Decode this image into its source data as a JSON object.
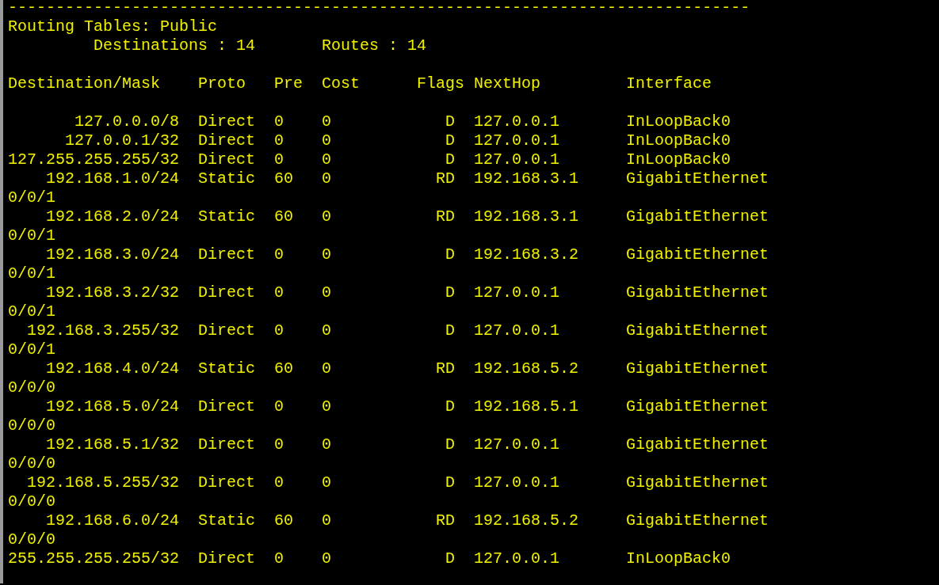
{
  "separator": "------------------------------------------------------------------------------",
  "title": "Routing Tables: Public",
  "summary": {
    "destinations": "Destinations : 14",
    "routes": "Routes : 14"
  },
  "columns": [
    "Destination/Mask",
    "Proto",
    "Pre",
    "Cost",
    "Flags",
    "NextHop",
    "Interface"
  ],
  "rows": [
    {
      "destination": "127.0.0.0/8",
      "proto": "Direct",
      "pre": "0",
      "cost": "0",
      "flags": "D",
      "nexthop": "127.0.0.1",
      "interface": "InLoopBack0"
    },
    {
      "destination": "127.0.0.1/32",
      "proto": "Direct",
      "pre": "0",
      "cost": "0",
      "flags": "D",
      "nexthop": "127.0.0.1",
      "interface": "InLoopBack0"
    },
    {
      "destination": "127.255.255.255/32",
      "proto": "Direct",
      "pre": "0",
      "cost": "0",
      "flags": "D",
      "nexthop": "127.0.0.1",
      "interface": "InLoopBack0"
    },
    {
      "destination": "192.168.1.0/24",
      "proto": "Static",
      "pre": "60",
      "cost": "0",
      "flags": "RD",
      "nexthop": "192.168.3.1",
      "interface": "GigabitEthernet",
      "interface_continued": "0/0/1"
    },
    {
      "destination": "192.168.2.0/24",
      "proto": "Static",
      "pre": "60",
      "cost": "0",
      "flags": "RD",
      "nexthop": "192.168.3.1",
      "interface": "GigabitEthernet",
      "interface_continued": "0/0/1"
    },
    {
      "destination": "192.168.3.0/24",
      "proto": "Direct",
      "pre": "0",
      "cost": "0",
      "flags": "D",
      "nexthop": "192.168.3.2",
      "interface": "GigabitEthernet",
      "interface_continued": "0/0/1"
    },
    {
      "destination": "192.168.3.2/32",
      "proto": "Direct",
      "pre": "0",
      "cost": "0",
      "flags": "D",
      "nexthop": "127.0.0.1",
      "interface": "GigabitEthernet",
      "interface_continued": "0/0/1"
    },
    {
      "destination": "192.168.3.255/32",
      "proto": "Direct",
      "pre": "0",
      "cost": "0",
      "flags": "D",
      "nexthop": "127.0.0.1",
      "interface": "GigabitEthernet",
      "interface_continued": "0/0/1"
    },
    {
      "destination": "192.168.4.0/24",
      "proto": "Static",
      "pre": "60",
      "cost": "0",
      "flags": "RD",
      "nexthop": "192.168.5.2",
      "interface": "GigabitEthernet",
      "interface_continued": "0/0/0"
    },
    {
      "destination": "192.168.5.0/24",
      "proto": "Direct",
      "pre": "0",
      "cost": "0",
      "flags": "D",
      "nexthop": "192.168.5.1",
      "interface": "GigabitEthernet",
      "interface_continued": "0/0/0"
    },
    {
      "destination": "192.168.5.1/32",
      "proto": "Direct",
      "pre": "0",
      "cost": "0",
      "flags": "D",
      "nexthop": "127.0.0.1",
      "interface": "GigabitEthernet",
      "interface_continued": "0/0/0"
    },
    {
      "destination": "192.168.5.255/32",
      "proto": "Direct",
      "pre": "0",
      "cost": "0",
      "flags": "D",
      "nexthop": "127.0.0.1",
      "interface": "GigabitEthernet",
      "interface_continued": "0/0/0"
    },
    {
      "destination": "192.168.6.0/24",
      "proto": "Static",
      "pre": "60",
      "cost": "0",
      "flags": "RD",
      "nexthop": "192.168.5.2",
      "interface": "GigabitEthernet",
      "interface_continued": "0/0/0"
    },
    {
      "destination": "255.255.255.255/32",
      "proto": "Direct",
      "pre": "0",
      "cost": "0",
      "flags": "D",
      "nexthop": "127.0.0.1",
      "interface": "InLoopBack0"
    }
  ]
}
